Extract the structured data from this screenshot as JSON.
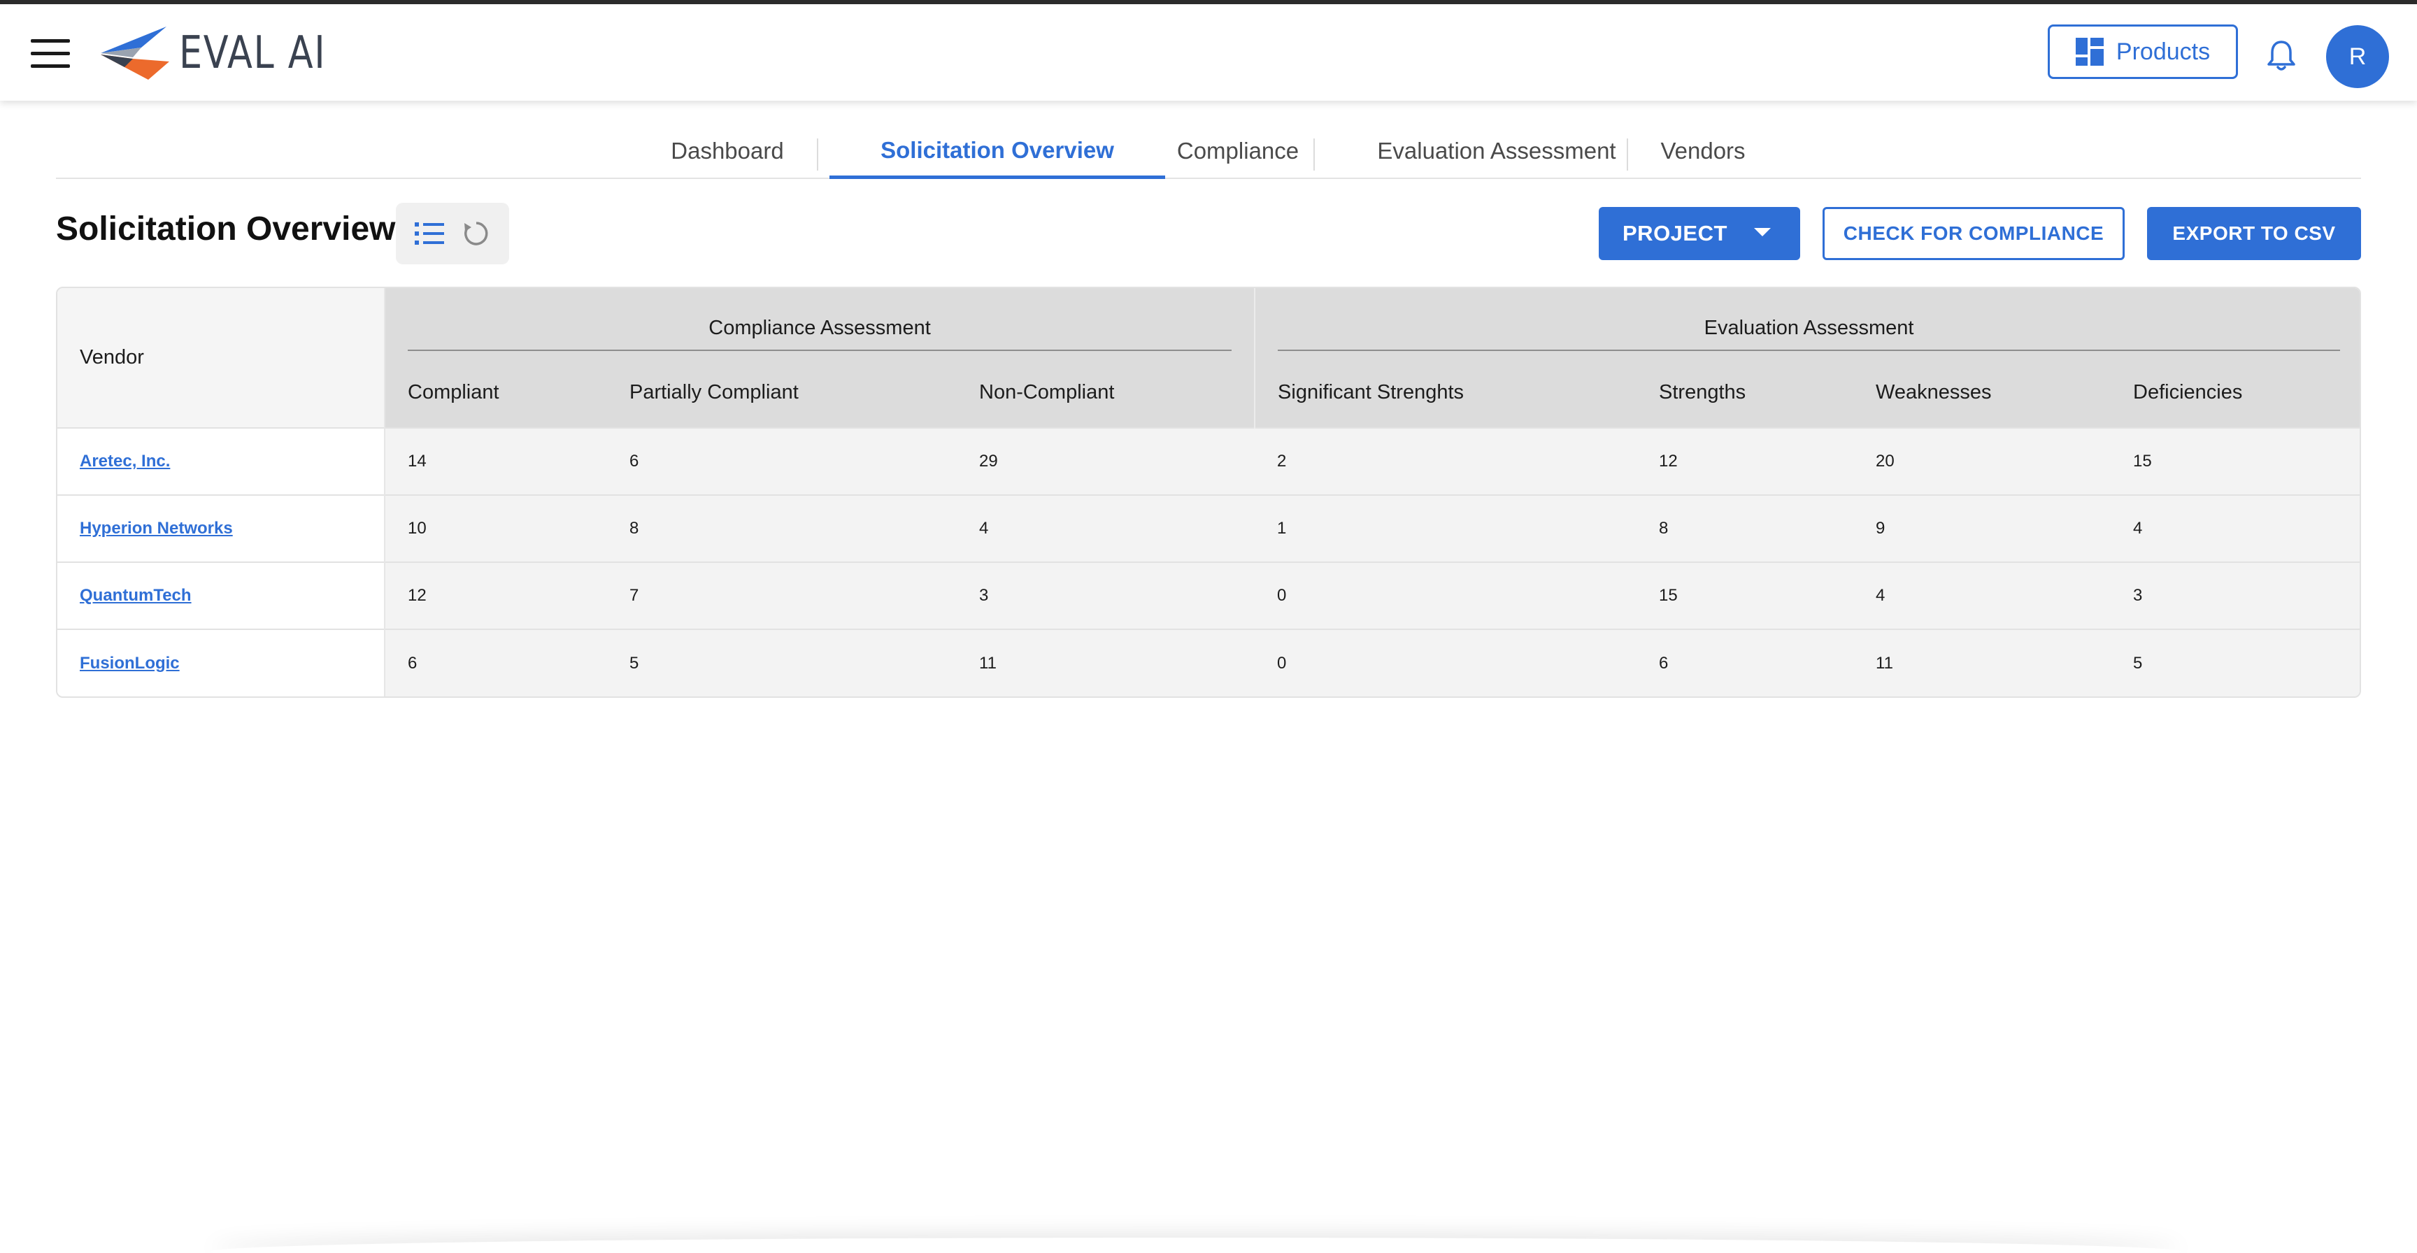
{
  "header": {
    "logo_text": "EVAL AI",
    "products_label": "Products",
    "avatar_initial": "R",
    "icons": [
      "menu-icon",
      "eval-ai-logo",
      "grid-icon",
      "bell-icon"
    ]
  },
  "tabs": [
    {
      "label": "Dashboard",
      "active": false
    },
    {
      "label": "Solicitation Overview",
      "active": true
    },
    {
      "label": "Compliance",
      "active": false
    },
    {
      "label": "Evaluation Assessment",
      "active": false
    },
    {
      "label": "Vendors",
      "active": false
    }
  ],
  "page": {
    "title": "Solicitation Overview",
    "view_toggle": [
      "list-icon",
      "refresh-icon"
    ]
  },
  "actions": {
    "project_label": "PROJECT",
    "check_label": "CHECK FOR COMPLIANCE",
    "export_label": "EXPORT TO CSV"
  },
  "table": {
    "vendor_header": "Vendor",
    "groups": {
      "compliance": "Compliance Assessment",
      "evaluation": "Evaluation Assessment"
    },
    "columns": [
      "Compliant",
      "Partially Compliant",
      "Non-Compliant",
      "Significant Strenghts",
      "Strengths",
      "Weaknesses",
      "Deficiencies"
    ],
    "rows": [
      {
        "vendor": "Aretec, Inc.",
        "values": [
          "14",
          "6",
          "29",
          "2",
          "12",
          "20",
          "15"
        ]
      },
      {
        "vendor": "Hyperion Networks",
        "values": [
          "10",
          "8",
          "4",
          "1",
          "8",
          "9",
          "4"
        ]
      },
      {
        "vendor": "QuantumTech",
        "values": [
          "12",
          "7",
          "3",
          "0",
          "15",
          "4",
          "3"
        ]
      },
      {
        "vendor": "FusionLogic",
        "values": [
          "6",
          "5",
          "11",
          "0",
          "6",
          "11",
          "5"
        ]
      }
    ]
  },
  "colors": {
    "accent": "#2f6fd6",
    "header_gray": "#dcdcdc",
    "row_gray": "#f3f3f3"
  }
}
